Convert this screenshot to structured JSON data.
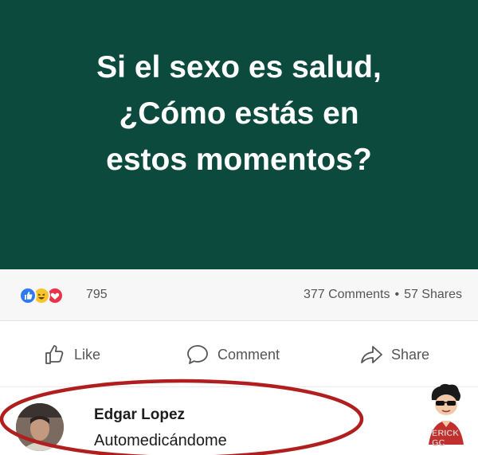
{
  "post": {
    "lines": [
      "Si el sexo es salud,",
      "¿Cómo estás en",
      "estos momentos?"
    ],
    "background_color": "#0c4a3e"
  },
  "stats": {
    "reaction_icons": [
      "like-reaction-icon",
      "haha-reaction-icon",
      "love-reaction-icon"
    ],
    "reaction_count": "795",
    "comments": "377 Comments",
    "separator": "•",
    "shares": "57 Shares"
  },
  "actions": {
    "like": "Like",
    "comment": "Comment",
    "share": "Share"
  },
  "comment": {
    "author": "Edgar Lopez",
    "text": "Automedicándome"
  },
  "watermark": {
    "label": "ERICK GC"
  },
  "colors": {
    "highlight_ellipse": "#b01e1e",
    "like_blue": "#2d7bf4",
    "love_red": "#e8334a",
    "haha_yellow": "#f7c52b"
  }
}
